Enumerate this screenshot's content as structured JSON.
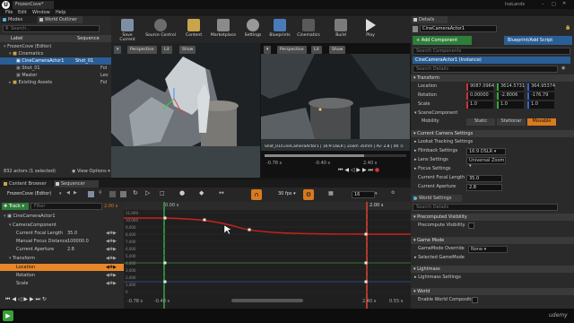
{
  "app": {
    "title": "FrozenCove*",
    "project": "IceLands",
    "menus": [
      "File",
      "Edit",
      "Window",
      "Help"
    ]
  },
  "modes": {
    "tab_modes": "Modes",
    "tab_outliner": "World Outliner"
  },
  "outliner": {
    "search_placeholder": "Search...",
    "col_label": "Label",
    "col_type": "Sequence",
    "items": [
      {
        "label": "FrozenCove (Editor)",
        "type": ""
      },
      {
        "label": "Cinematics",
        "type": ""
      },
      {
        "label": "CineCameraActor1",
        "type": "Shot_01"
      },
      {
        "label": "Shot_01",
        "type": "Fol"
      },
      {
        "label": "Master",
        "type": "Lev"
      },
      {
        "label": "Existing Assets",
        "type": "Fol"
      }
    ],
    "status": "832 actors (1 selected)",
    "view_options": "View Options"
  },
  "toolbar": {
    "buttons": [
      "Save Current",
      "Source Control",
      "Content",
      "Marketplace",
      "Settings",
      "Blueprints",
      "Cinematics",
      "Build",
      "Play"
    ]
  },
  "viewport_left": {
    "perspective": "Perspective",
    "lit": "Lit",
    "show": "Show"
  },
  "viewport_right": {
    "perspective": "Perspective",
    "lit": "Lit",
    "show": "Show",
    "shot_info": "Shot_01/CineCameraActor1 | 16:9 DSLR | Zoom 35mm | Av: 2.8 | 00 :s",
    "time_left": "-0.78 s",
    "time_mid": "-0.40 s",
    "time_right": "2.40 s"
  },
  "content_browser": {
    "tab": "Content Browser",
    "sequencer_tab": "Sequencer"
  },
  "sequencer": {
    "sequence_name": "FrozenCove (Editor)",
    "track_button": "Track",
    "filter_placeholder": "Filter",
    "time_field": "2.00 s",
    "fps": "30 fps",
    "frame_value": "16",
    "tracks": [
      {
        "label": "CineCameraActor1",
        "value": ""
      },
      {
        "label": "CameraComponent",
        "value": ""
      },
      {
        "label": "Current Focal Length",
        "value": "35.0"
      },
      {
        "label": "Manual Focus Distance",
        "value": "100000.0"
      },
      {
        "label": "Current Aperture",
        "value": "2.8"
      },
      {
        "label": "Transform",
        "value": ""
      },
      {
        "label": "Location",
        "value": ""
      },
      {
        "label": "Rotation",
        "value": ""
      },
      {
        "label": "Scale",
        "value": ""
      }
    ],
    "curve_labels": [
      "11,000",
      "10,000",
      "9,000",
      "8,000",
      "7,000",
      "6,000",
      "5,000",
      "4,000",
      "3,000",
      "2,000",
      "1,000",
      "0"
    ],
    "playhead": "2.00 s",
    "time_start": "-0.78 s",
    "time_start2": "-0.40 s",
    "time_end": "2.40 s",
    "time_end2": "0.55 s",
    "section_start": "0.00 s"
  },
  "details": {
    "tab": "Details",
    "world_settings_tab": "World Settings",
    "actor_name": "CineCameraActor1",
    "add_component": "+ Add Component",
    "blueprint": "Blueprint/Add Script",
    "search_placeholder": "Search Components",
    "component_root": "CineCameraActor1 (Instance)",
    "search_details_placeholder": "Search Details",
    "transform": "Transform",
    "location_label": "Location",
    "location": [
      "9087.0964",
      "3614.5731",
      "364.95374"
    ],
    "rotation_label": "Rotation",
    "rotation": [
      "0.00000",
      "-2.8006",
      "-176.79"
    ],
    "scale_label": "Scale",
    "scale": [
      "1.0",
      "1.0",
      "1.0"
    ],
    "scene_component": "SceneComponent",
    "mobility_label": "Mobility",
    "mobility": [
      "Static",
      "Stationar",
      "Movable"
    ],
    "camera_section": "Current Camera Settings",
    "lookat": "Lookat Tracking Settings",
    "filmback_label": "Filmback Settings",
    "filmback_value": "16:9 DSLR",
    "lens_label": "Lens Settings",
    "lens_value": "Universal Zoom",
    "focus_label": "Focus Settings",
    "focal_label": "Current Focal Length",
    "focal_value": "35.0",
    "aperture_label": "Current Aperture",
    "aperture_value": "2.8"
  },
  "world_settings": {
    "search_placeholder": "Search Details",
    "precomputed": "Precomputed Visibility",
    "precomputed_row": "Precompute Visibility",
    "gamemode": "Game Mode",
    "gamemode_override": "GameMode Override",
    "gamemode_value": "None",
    "selected_gamemode": "Selected GameMode",
    "lightmass": "Lightmass",
    "lightmass_settings": "Lightmass Settings",
    "world": "World",
    "world_composition": "Enable World Compositio"
  }
}
